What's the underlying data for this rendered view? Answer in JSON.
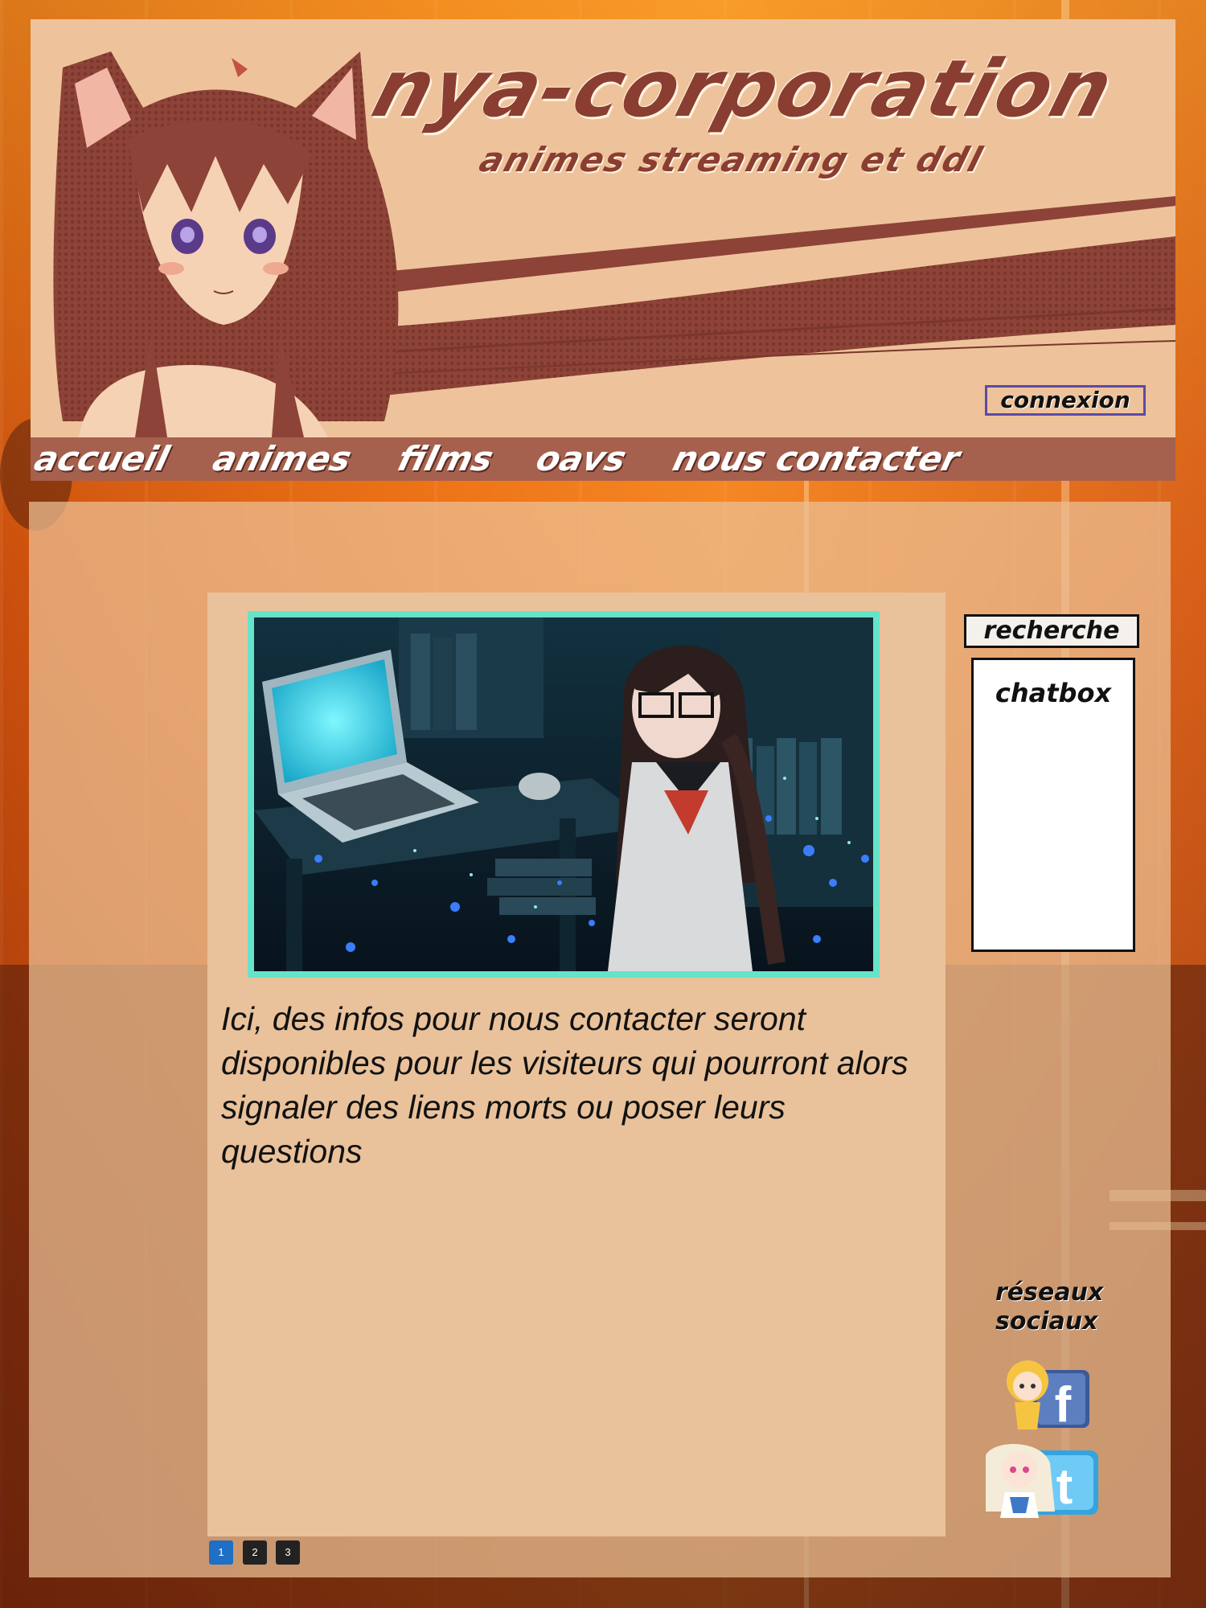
{
  "header": {
    "title": "nya-corporation",
    "subtitle": "animes streaming et ddl",
    "connexion_label": "connexion"
  },
  "nav": {
    "items": [
      {
        "label": "accueil"
      },
      {
        "label": "animes"
      },
      {
        "label": "films"
      },
      {
        "label": "oavs"
      },
      {
        "label": "nous contacter"
      }
    ]
  },
  "main": {
    "text": "Ici, des infos pour nous contacter seront disponibles pour les visiteurs qui pourront alors  signaler des liens morts ou poser leurs questions"
  },
  "sidebar": {
    "search_label": "recherche",
    "chatbox_title": "chatbox",
    "social_heading_line1": "réseaux",
    "social_heading_line2": "sociaux",
    "social_icons": [
      "facebook-icon",
      "twitter-icon"
    ]
  },
  "pagination": {
    "pages": [
      "1",
      "2",
      "3"
    ],
    "active": "1"
  },
  "colors": {
    "header_bg": "#eec39b",
    "nav_bg": "#a6604e",
    "title_color": "#8a3d31",
    "image_border": "#66e3c8",
    "active_page": "#1f6fc4"
  }
}
